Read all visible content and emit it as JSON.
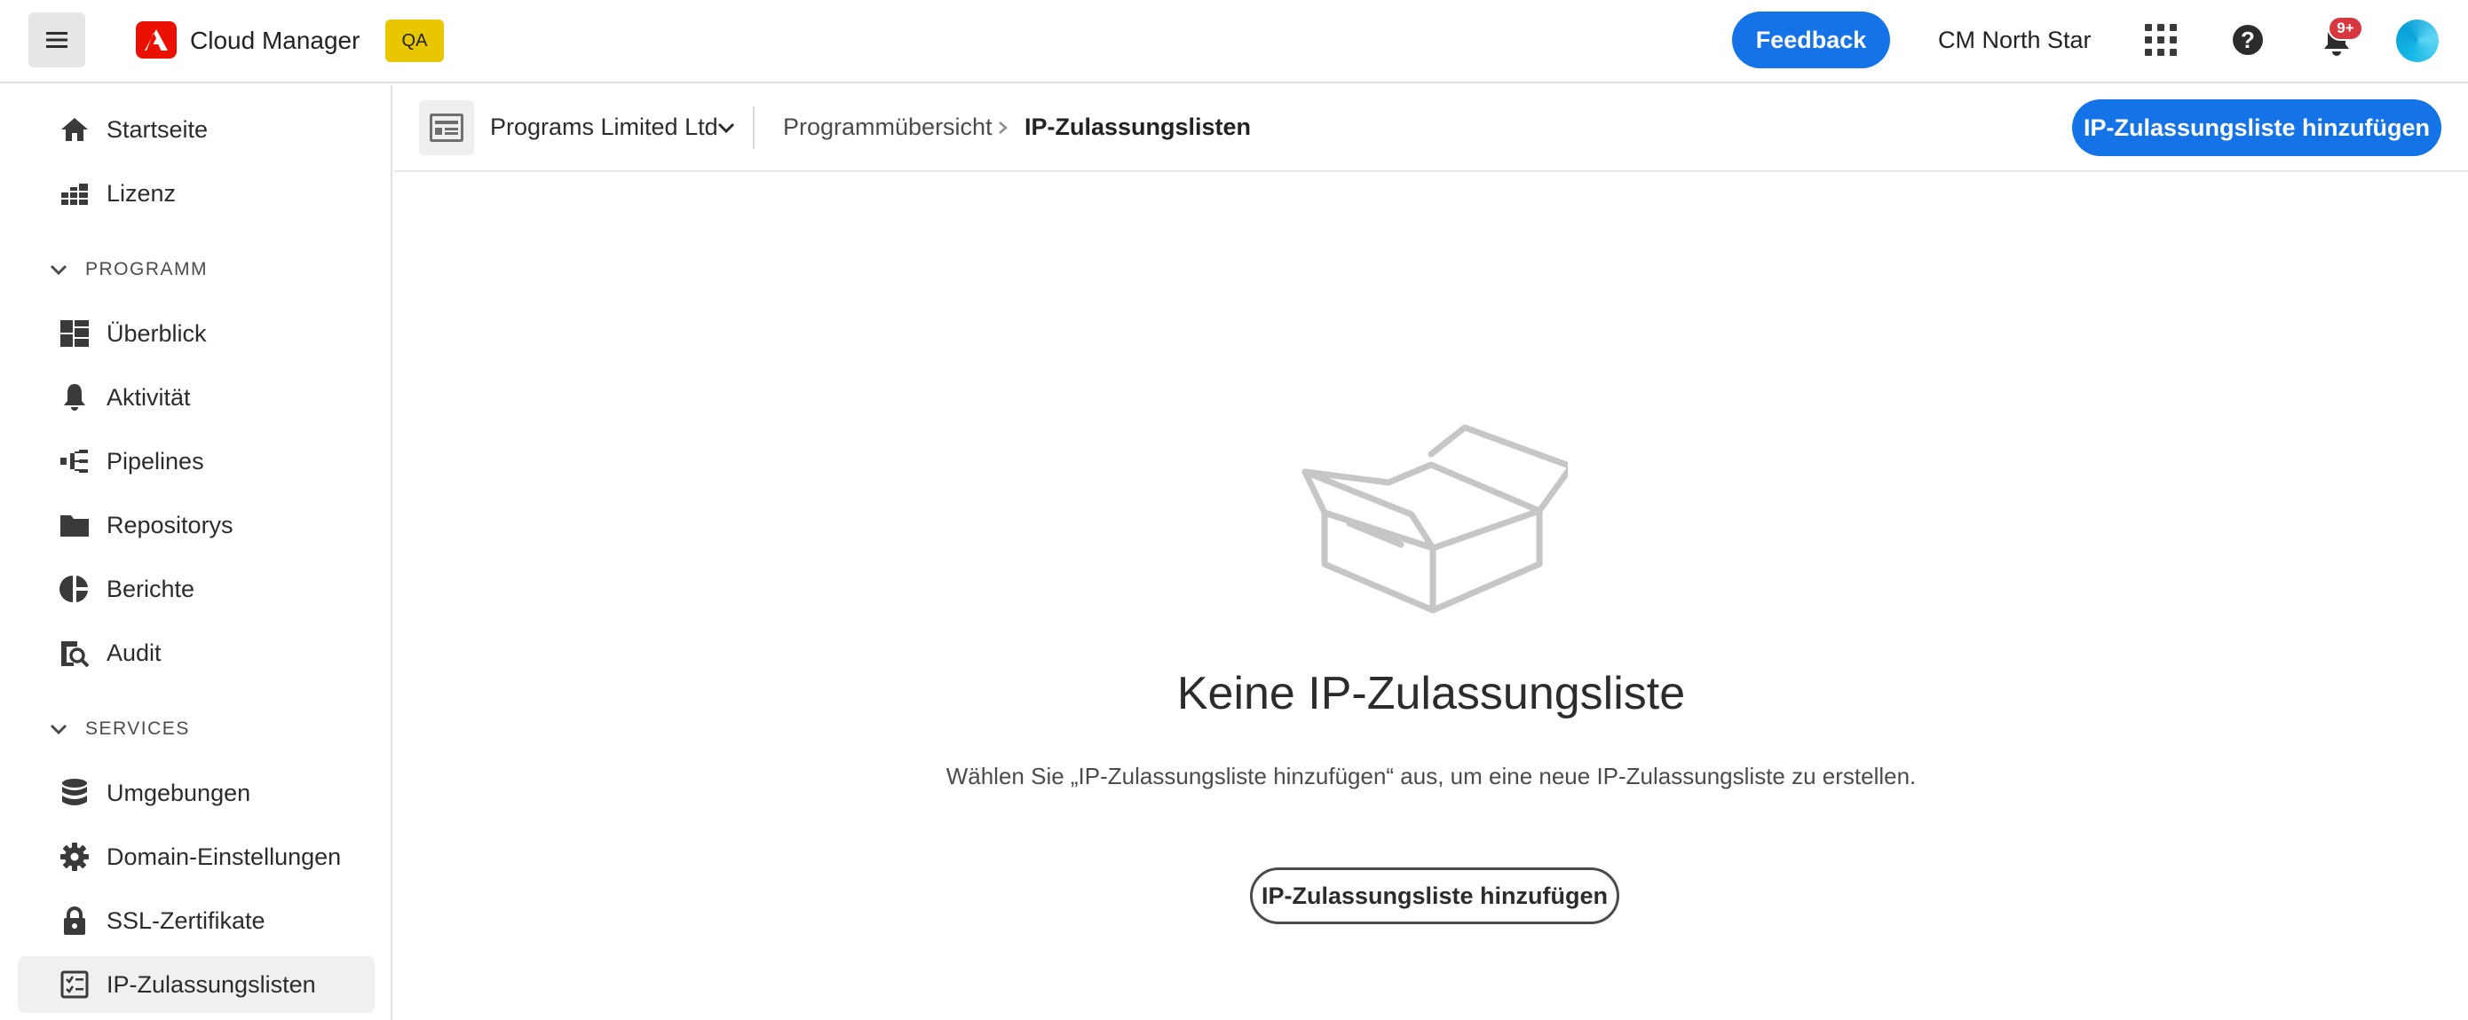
{
  "header": {
    "app_title": "Cloud Manager",
    "env_badge": "QA",
    "feedback_label": "Feedback",
    "org_name": "CM North Star",
    "notification_count": "9+",
    "brand_color": "#eb1000",
    "accent_color": "#1473e6"
  },
  "sidebar": {
    "top_items": [
      {
        "label": "Startseite",
        "icon": "home-icon"
      },
      {
        "label": "Lizenz",
        "icon": "license-icon"
      }
    ],
    "sections": [
      {
        "title": "PROGRAMM",
        "items": [
          {
            "label": "Überblick",
            "icon": "overview-icon"
          },
          {
            "label": "Aktivität",
            "icon": "bell-icon"
          },
          {
            "label": "Pipelines",
            "icon": "pipeline-icon"
          },
          {
            "label": "Repositorys",
            "icon": "folder-icon"
          },
          {
            "label": "Berichte",
            "icon": "reports-icon"
          },
          {
            "label": "Audit",
            "icon": "audit-icon"
          }
        ]
      },
      {
        "title": "SERVICES",
        "items": [
          {
            "label": "Umgebungen",
            "icon": "database-icon"
          },
          {
            "label": "Domain-Einstellungen",
            "icon": "gear-icon"
          },
          {
            "label": "SSL-Zertifikate",
            "icon": "lock-icon"
          },
          {
            "label": "IP-Zulassungslisten",
            "icon": "checklist-icon",
            "active": true
          }
        ]
      }
    ]
  },
  "subheader": {
    "program_name": "Programs Limited Ltd",
    "breadcrumb": [
      "Programmübersicht",
      "IP-Zulassungslisten"
    ],
    "add_button_label": "IP-Zulassungsliste hinzufügen"
  },
  "empty_state": {
    "illustration": "open-box-icon",
    "title": "Keine IP-Zulassungsliste",
    "description": "Wählen Sie „IP-Zulassungsliste hinzufügen“ aus, um eine neue IP-Zulassungsliste zu erstellen.",
    "button_label": "IP-Zulassungsliste hinzufügen"
  }
}
